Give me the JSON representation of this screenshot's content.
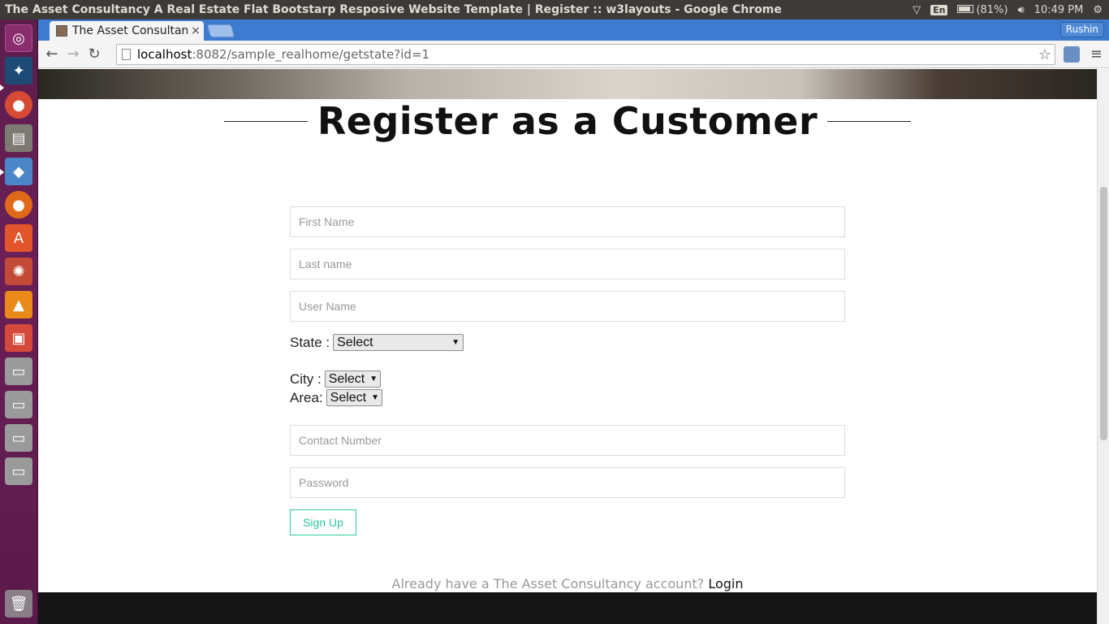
{
  "os": {
    "window_title": "The Asset Consultancy A Real Estate Flat Bootstarp Resposive Website Template | Register :: w3layouts - Google Chrome",
    "keyboard": "En",
    "battery": "(81%)",
    "clock": "10:49 PM"
  },
  "browser": {
    "tab_title": "The Asset Consultan",
    "tab_close": "×",
    "profile": "Rushin",
    "url_host": "localhost",
    "url_path": ":8082/sample_realhome/getstate?id=1",
    "star": "☆"
  },
  "page": {
    "heading": "Register as a Customer",
    "first_name_placeholder": "First Name",
    "last_name_placeholder": "Last name",
    "user_name_placeholder": "User Name",
    "state_label": "State :",
    "state_value": "Select",
    "city_label": "City :",
    "city_value": "Select",
    "area_label": "Area:",
    "area_value": "Select",
    "contact_placeholder": "Contact Number",
    "password_placeholder": "Password",
    "signup_label": "Sign Up",
    "already_text": "Already have a The Asset Consultancy account?",
    "login_link": "Login"
  },
  "colors": {
    "accent": "#2fc6a4",
    "launcher": "#5b1e4b"
  }
}
